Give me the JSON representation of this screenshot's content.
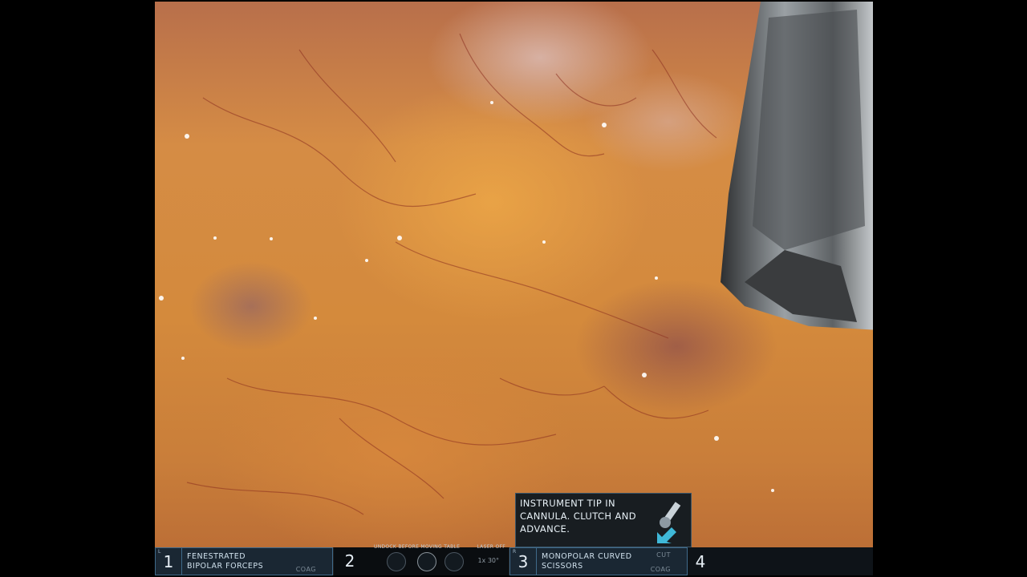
{
  "toast": {
    "message": "INSTRUMENT TIP IN CANNULA. CLUTCH AND ADVANCE."
  },
  "arms": [
    {
      "number": "1",
      "side_mark": "L",
      "label": "FENESTRATED BIPOLAR FORCEPS",
      "mode_bottom": "COAG"
    },
    {
      "number": "2",
      "undock_text": "UNDOCK BEFORE MOVING TABLE",
      "laser_text": "LASER OFF",
      "scope_text": "1x 30°"
    },
    {
      "number": "3",
      "side_mark": "R",
      "label": "MONOPOLAR CURVED SCISSORS",
      "mode_top": "CUT",
      "mode_bottom": "COAG"
    },
    {
      "number": "4"
    }
  ],
  "colors": {
    "active_panel": "#1a2733",
    "active_border": "#3f6a8a",
    "toast_arrow": "#3fb8d8"
  },
  "icons": [
    "instrument-tip-icon",
    "arrow-down-left-icon",
    "disable-table-icon",
    "camera-dial-icon",
    "scope-icon"
  ]
}
